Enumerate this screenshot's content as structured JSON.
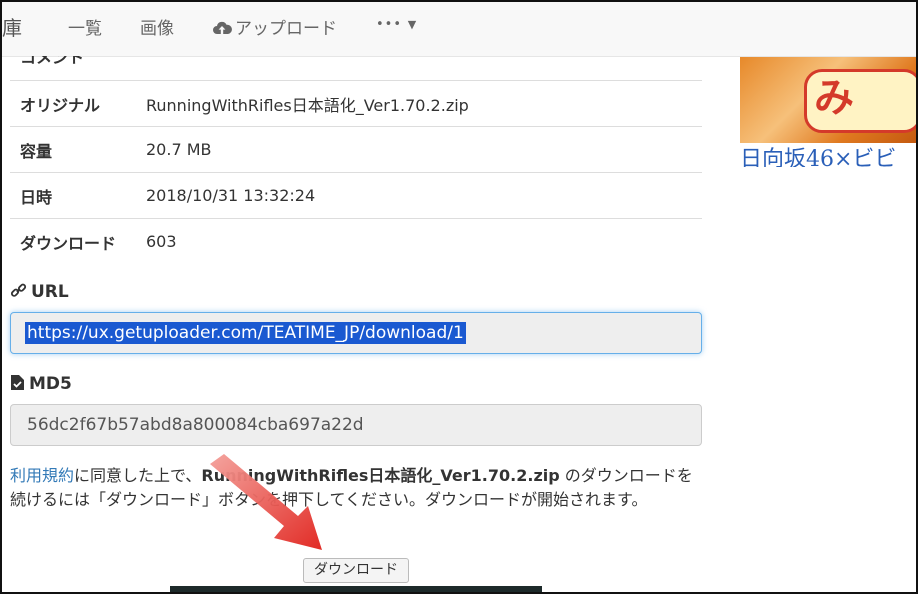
{
  "nav": {
    "brand": "庫",
    "items": [
      "一覧",
      "画像"
    ],
    "upload": "アップロード",
    "more": "•••"
  },
  "info_rows": [
    {
      "key": "コメント",
      "value": ""
    },
    {
      "key": "オリジナル",
      "value": "RunningWithRifles日本語化_Ver1.70.2.zip"
    },
    {
      "key": "容量",
      "value": "20.7 MB"
    },
    {
      "key": "日時",
      "value": "2018/10/31 13:32:24"
    },
    {
      "key": "ダウンロード",
      "value": "603"
    }
  ],
  "url_section": {
    "label": "URL",
    "value": "https://ux.getuploader.com/TEATIME_JP/download/1"
  },
  "md5_section": {
    "label": "MD5",
    "value": "56dc2f67b57abd8a800084cba697a22d"
  },
  "notice": {
    "terms_link": "利用規約",
    "part1": "に同意した上で、",
    "filename": "RunningWithRifles日本語化_Ver1.70.2.zip",
    "part2": " のダウンロードを続けるには「ダウンロード」ボタンを押下してください。ダウンロードが開始されます。"
  },
  "download_button": "ダウンロード",
  "ad": {
    "logo_text": "み",
    "caption": "日向坂46×ビビ"
  },
  "colors": {
    "link": "#337ab7",
    "selection": "#1a59d1",
    "arrow": "#e0201a"
  }
}
